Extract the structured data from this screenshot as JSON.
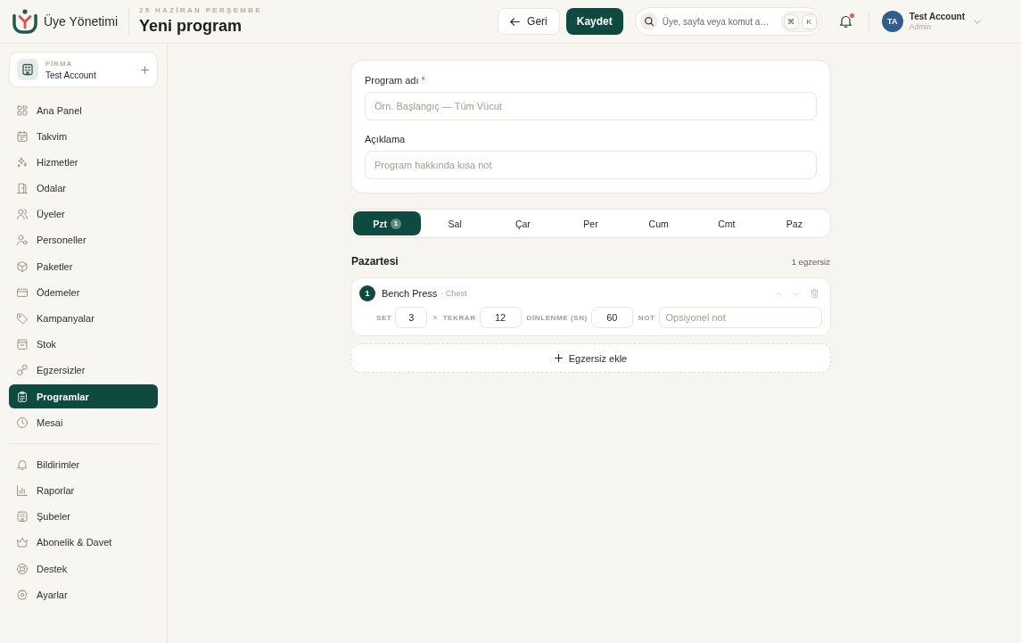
{
  "app": {
    "name": "Üye Yönetimi"
  },
  "header": {
    "date": "25 HAZİRAN PERŞEMBE",
    "title": "Yeni program",
    "back_button": "Geri",
    "save_button": "Kaydet",
    "search": {
      "placeholder": "Üye, sayfa veya komut a…",
      "shortcut_keys": [
        "⌘",
        "K"
      ]
    },
    "notifications": {
      "unread": true
    },
    "user": {
      "initials": "TA",
      "name": "Test Account",
      "role": "Admin"
    }
  },
  "sidebar": {
    "company": {
      "label": "FİRMA",
      "name": "Test Account"
    },
    "sections": [
      {
        "items": [
          {
            "label": "Ana Panel",
            "selected": false
          },
          {
            "label": "Takvim",
            "selected": false
          },
          {
            "label": "Hizmetler",
            "selected": false
          },
          {
            "label": "Odalar",
            "selected": false
          },
          {
            "label": "Üyeler",
            "selected": false
          },
          {
            "label": "Personeller",
            "selected": false
          },
          {
            "label": "Paketler",
            "selected": false
          },
          {
            "label": "Ödemeler",
            "selected": false
          },
          {
            "label": "Kampanyalar",
            "selected": false
          },
          {
            "label": "Stok",
            "selected": false
          },
          {
            "label": "Egzersizler",
            "selected": false
          },
          {
            "label": "Programlar",
            "selected": true
          },
          {
            "label": "Mesai",
            "selected": false
          }
        ]
      },
      {
        "items": [
          {
            "label": "Bildirimler",
            "selected": false
          },
          {
            "label": "Raporlar",
            "selected": false
          },
          {
            "label": "Şubeler",
            "selected": false
          },
          {
            "label": "Abonelik & Davet",
            "selected": false
          },
          {
            "label": "Destek",
            "selected": false
          },
          {
            "label": "Ayarlar",
            "selected": false
          }
        ]
      }
    ]
  },
  "program_form": {
    "fields": [
      {
        "label": "Program adı",
        "required_mark": "*",
        "placeholder": "Örn. Başlangıç — Tüm Vücut"
      },
      {
        "label": "Açıklama",
        "placeholder": "Program hakkında kısa not"
      }
    ]
  },
  "day_tabs": [
    {
      "label": "Pzt",
      "selected": true,
      "count": "1"
    },
    {
      "label": "Sal",
      "selected": false
    },
    {
      "label": "Çar",
      "selected": false
    },
    {
      "label": "Per",
      "selected": false
    },
    {
      "label": "Cum",
      "selected": false
    },
    {
      "label": "Cmt",
      "selected": false
    },
    {
      "label": "Paz",
      "selected": false
    }
  ],
  "day": {
    "title": "Pazartesi",
    "count": "1 egzersiz",
    "exercises": [
      {
        "number": "1",
        "name": "Bench Press",
        "category": "· Chest",
        "move_up_disabled": true,
        "move_down_disabled": true,
        "params": [
          {
            "kind": "number",
            "label": "SET",
            "value": "3"
          },
          {
            "kind": "number",
            "prefix": "×",
            "label": "TEKRAR",
            "value": "12"
          },
          {
            "kind": "number",
            "label": "DİNLENME (SN)",
            "value": "60"
          },
          {
            "kind": "text",
            "label": "NOT",
            "placeholder": "Opsiyonel not"
          }
        ]
      }
    ]
  },
  "add_exercise_button": "Egzersiz ekle"
}
